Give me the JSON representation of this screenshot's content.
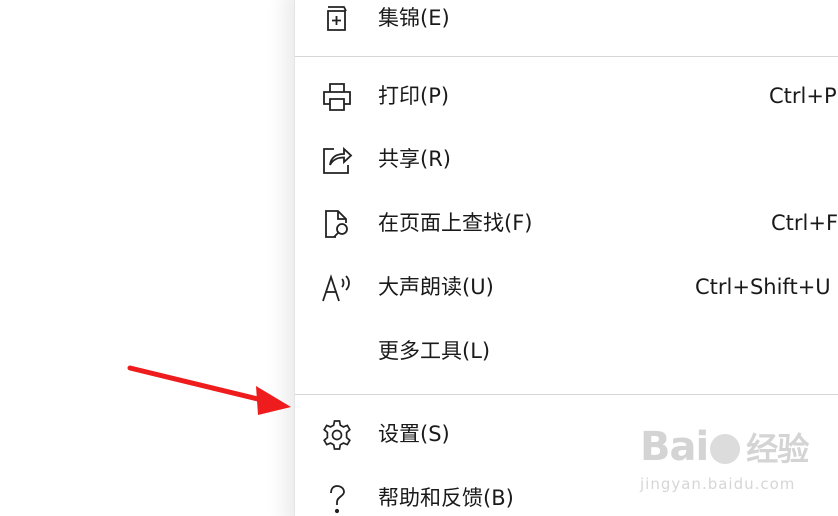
{
  "menu": {
    "items": [
      {
        "label": "集锦(E)",
        "icon": "collections-icon",
        "shortcut": ""
      },
      {
        "label": "打印(P)",
        "icon": "print-icon",
        "shortcut": "Ctrl+P"
      },
      {
        "label": "共享(R)",
        "icon": "share-icon",
        "shortcut": ""
      },
      {
        "label": "在页面上查找(F)",
        "icon": "find-on-page-icon",
        "shortcut": "Ctrl+F"
      },
      {
        "label": "大声朗读(U)",
        "icon": "read-aloud-icon",
        "shortcut": "Ctrl+Shift+U"
      },
      {
        "label": "更多工具(L)",
        "icon": "",
        "shortcut": ""
      },
      {
        "label": "设置(S)",
        "icon": "gear-icon",
        "shortcut": ""
      },
      {
        "label": "帮助和反馈(B)",
        "icon": "help-icon",
        "shortcut": ""
      }
    ]
  },
  "annotation": {
    "arrow_color": "#ee1c1c",
    "points_to": "设置(S)"
  },
  "watermark": {
    "logo_left": "Bai",
    "logo_right": "经验",
    "url": "jingyan.baidu.com"
  }
}
